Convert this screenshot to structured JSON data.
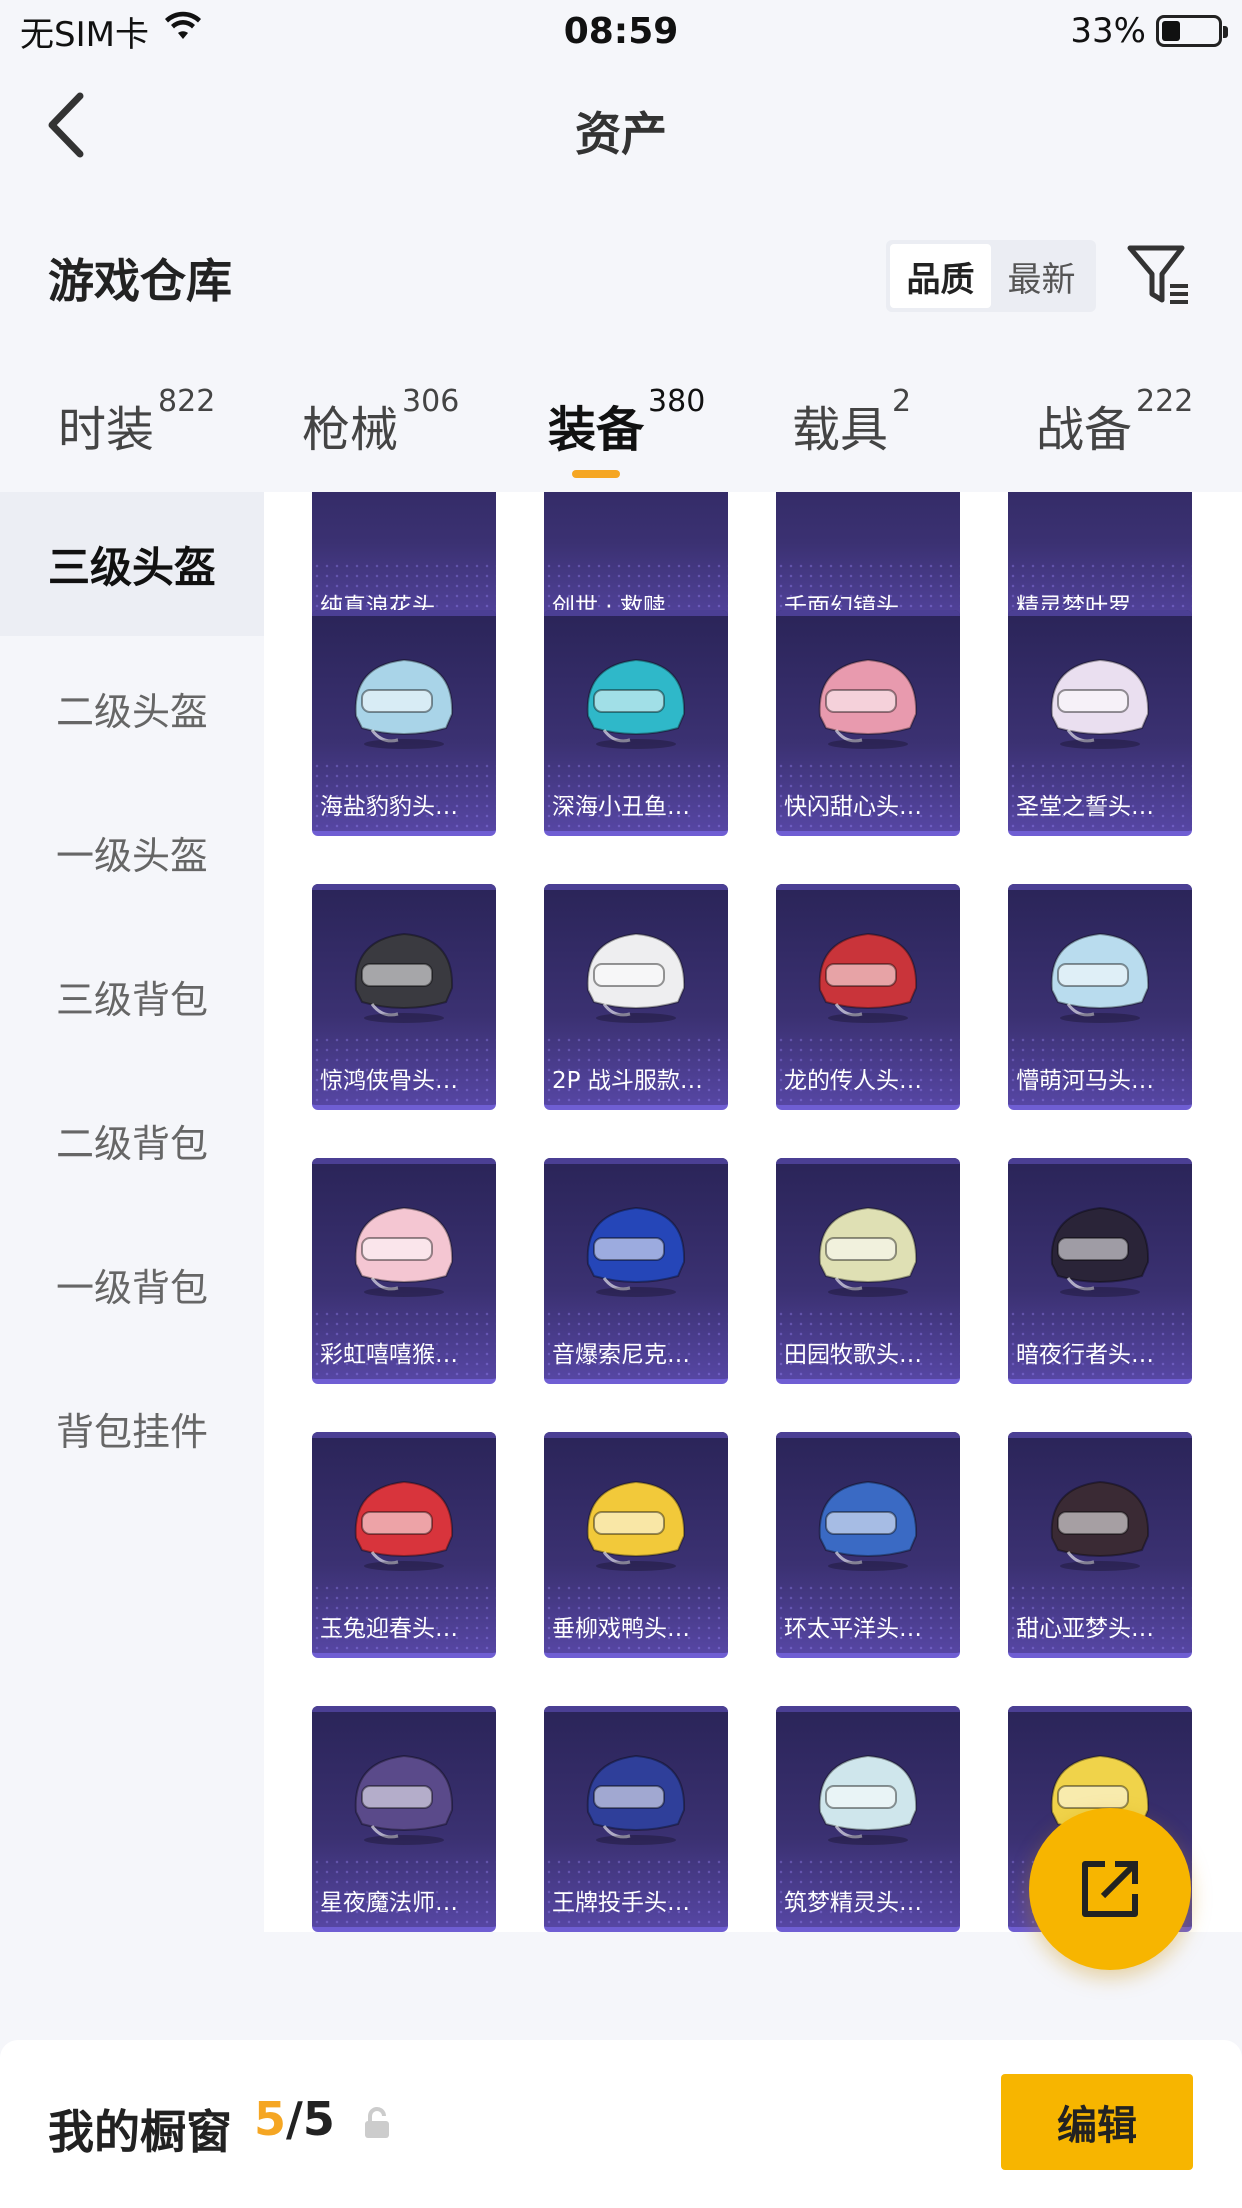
{
  "status_bar": {
    "carrier": "无SIM卡",
    "time": "08:59",
    "battery_percent": "33%",
    "battery_level": 0.33
  },
  "nav": {
    "title": "资产"
  },
  "warehouse": {
    "title": "游戏仓库",
    "sort_options": [
      {
        "label": "品质",
        "active": true
      },
      {
        "label": "最新",
        "active": false
      }
    ]
  },
  "tabs": [
    {
      "label": "时装",
      "count": "822"
    },
    {
      "label": "枪械",
      "count": "306"
    },
    {
      "label": "装备",
      "count": "380",
      "active": true
    },
    {
      "label": "载具",
      "count": "2"
    },
    {
      "label": "战备",
      "count": "222"
    }
  ],
  "sidebar": {
    "items": [
      {
        "label": "三级头盔",
        "active": true
      },
      {
        "label": "二级头盔"
      },
      {
        "label": "一级头盔"
      },
      {
        "label": "三级背包"
      },
      {
        "label": "二级背包"
      },
      {
        "label": "一级背包"
      },
      {
        "label": "背包挂件"
      }
    ]
  },
  "items": [
    {
      "label": "纯真浪花头…"
    },
    {
      "label": "创世 · 救赎…"
    },
    {
      "label": "千面幻镜头…"
    },
    {
      "label": "精灵梦叶罗…"
    },
    {
      "label": "海盐豹豹头…",
      "color": "#a9d4e8"
    },
    {
      "label": "深海小丑鱼…",
      "color": "#2fb8c9"
    },
    {
      "label": "快闪甜心头…",
      "color": "#e89aae"
    },
    {
      "label": "圣堂之誓头…",
      "color": "#eadff0"
    },
    {
      "label": "惊鸿侠骨头…",
      "color": "#3a3a40"
    },
    {
      "label": "2P 战斗服款…",
      "color": "#eeeef0"
    },
    {
      "label": "龙的传人头…",
      "color": "#c9343a"
    },
    {
      "label": "懵萌河马头…",
      "color": "#b9dcee"
    },
    {
      "label": "彩虹嘻嘻猴…",
      "color": "#f4c6d2"
    },
    {
      "label": "音爆索尼克…",
      "color": "#2546b8"
    },
    {
      "label": "田园牧歌头…",
      "color": "#dfe0b4"
    },
    {
      "label": "暗夜行者头…",
      "color": "#2a2438"
    },
    {
      "label": "玉兔迎春头…",
      "color": "#d8343c"
    },
    {
      "label": "垂柳戏鸭头…",
      "color": "#f2c93a"
    },
    {
      "label": "环太平洋头…",
      "color": "#3a6ac4"
    },
    {
      "label": "甜心亚梦头…",
      "color": "#3a2a34"
    },
    {
      "label": "星夜魔法师…",
      "color": "#5a4a8a"
    },
    {
      "label": "王牌投手头…",
      "color": "#2f3f9a"
    },
    {
      "label": "筑梦精灵头…",
      "color": "#cfe6ec"
    },
    {
      "label": "",
      "color": "#f0d34a"
    }
  ],
  "showcase": {
    "title": "我的橱窗",
    "current": "5",
    "total": "/5",
    "edit_label": "编辑"
  },
  "colors": {
    "accent": "#f7b500",
    "card_bg": "#3b3172"
  }
}
